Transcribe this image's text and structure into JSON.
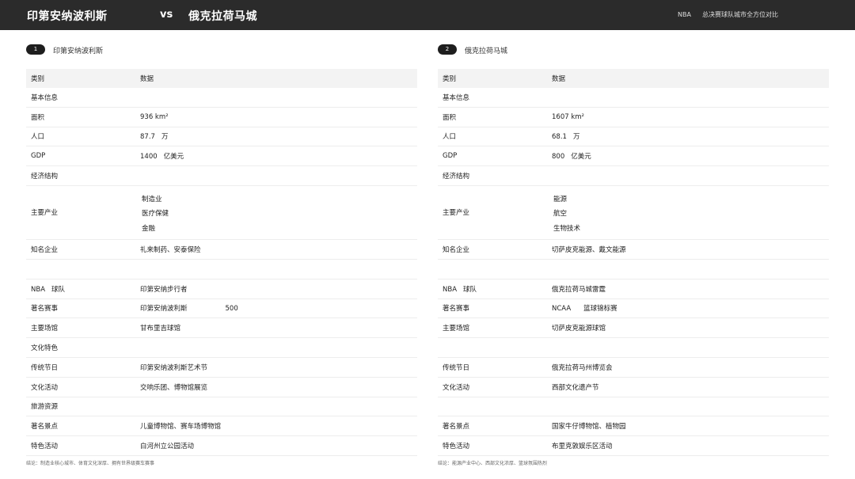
{
  "header": {
    "city_a": "印第安纳波利斯",
    "vs": "vs",
    "city_b": "俄克拉荷马城",
    "league": "NBA",
    "subtitle": "总决赛球队城市全方位对比"
  },
  "panels": [
    {
      "badge": "1",
      "title": "印第安纳波利斯",
      "col_category": "类别",
      "col_data": "数据",
      "basic_info": "基本信息",
      "area_label": "面积",
      "area_value": "936 km²",
      "pop_label": "人口",
      "pop_value": "87.7",
      "pop_unit": "万",
      "gdp_label": "GDP",
      "gdp_value": "1400",
      "gdp_unit": "亿美元",
      "economy": "经济结构",
      "industry_label": "主要产业",
      "industries": [
        "制造业",
        "医疗保健",
        "金融"
      ],
      "companies_label": "知名企业",
      "companies_value": "礼来制药、安泰保险",
      "team_prefix": "NBA",
      "team_label": "球队",
      "team_value": "印第安纳步行者",
      "events_label": "著名赛事",
      "events_value_a": "印第安纳波利斯",
      "events_value_b": "500",
      "arena_label": "主要场馆",
      "arena_value": "甘布里吉球馆",
      "culture": "文化特色",
      "festival_label": "传统节日",
      "festival_value": "印第安纳波利斯艺术节",
      "activity_label": "文化活动",
      "activity_value": "交响乐团、博物馆展览",
      "tourism": "旅游资源",
      "sights_label": "著名景点",
      "sights_value": "儿童博物馆、赛车场博物馆",
      "special_label": "特色活动",
      "special_value": "白河州立公园活动",
      "footer": "结论：制造业核心城市、体育文化深厚、拥有世界级赛车赛事"
    },
    {
      "badge": "2",
      "title": "俄克拉荷马城",
      "col_category": "类别",
      "col_data": "数据",
      "basic_info": "基本信息",
      "area_label": "面积",
      "area_value": "1607 km²",
      "pop_label": "人口",
      "pop_value": "68.1",
      "pop_unit": "万",
      "gdp_label": "GDP",
      "gdp_value": "800",
      "gdp_unit": "亿美元",
      "economy": "经济结构",
      "industry_label": "主要产业",
      "industries": [
        "能源",
        "航空",
        "生物技术"
      ],
      "companies_label": "知名企业",
      "companies_value": "切萨皮克能源、戴文能源",
      "team_prefix": "NBA",
      "team_label": "球队",
      "team_value": "俄克拉荷马城雷霆",
      "events_label": "著名赛事",
      "events_value_a": "NCAA",
      "events_value_b": "篮球锦标赛",
      "arena_label": "主要场馆",
      "arena_value": "切萨皮克能源球馆",
      "culture": "",
      "festival_label": "传统节日",
      "festival_value": "俄克拉荷马州博览会",
      "activity_label": "文化活动",
      "activity_value": "西部文化遗产节",
      "tourism": "",
      "sights_label": "著名景点",
      "sights_value": "国家牛仔博物馆、植物园",
      "special_label": "特色活动",
      "special_value": "布里克敦娱乐区活动",
      "footer": "结论：能源产业中心、西部文化浓厚、篮球氛围热烈"
    }
  ]
}
